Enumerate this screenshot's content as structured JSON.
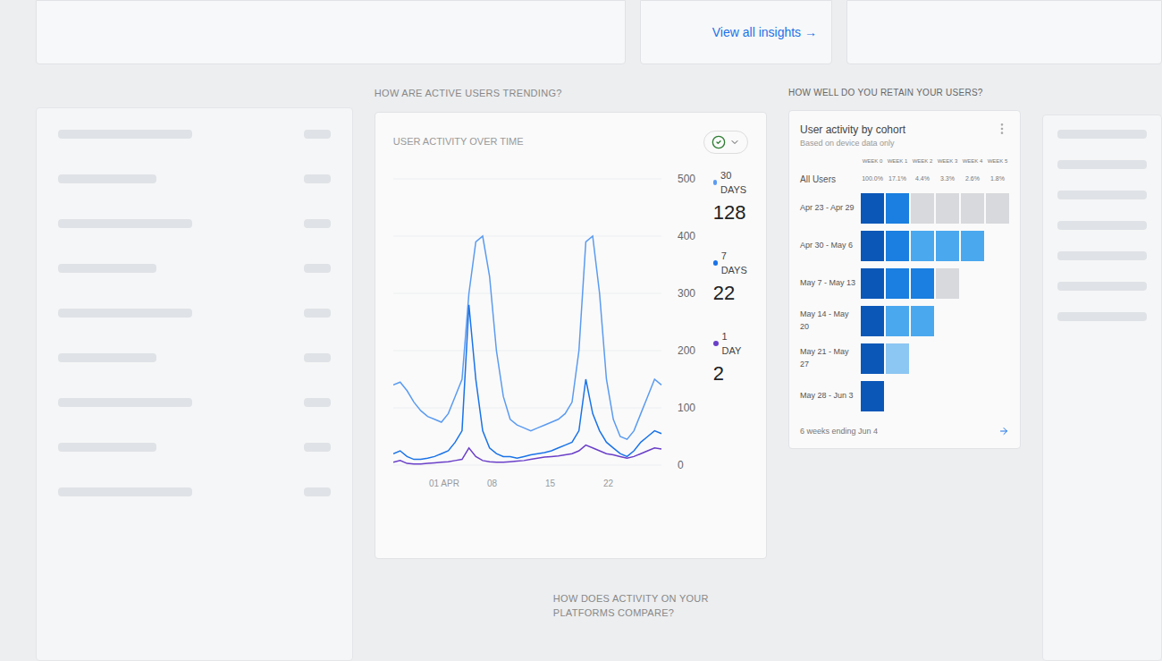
{
  "top_cards": {
    "link": "View all insights →"
  },
  "trend_section": {
    "heading": "HOW ARE ACTIVE USERS TRENDING?",
    "chart": {
      "title": "USER ACTIVITY OVER TIME",
      "y_ticks": [
        "500",
        "400",
        "300",
        "200",
        "100",
        "0"
      ],
      "x_ticks": [
        "01 APR",
        "08",
        "15",
        "22"
      ],
      "series": [
        {
          "label": "30 DAYS",
          "value": "128",
          "color": "#5b9bf0",
          "values": [
            140,
            145,
            130,
            110,
            95,
            85,
            80,
            75,
            90,
            120,
            150,
            300,
            390,
            400,
            330,
            200,
            120,
            80,
            70,
            65,
            60,
            65,
            70,
            75,
            80,
            90,
            110,
            200,
            390,
            400,
            300,
            150,
            80,
            50,
            45,
            60,
            90,
            120,
            150,
            140
          ]
        },
        {
          "label": "7 DAYS",
          "value": "22",
          "color": "#1a73e8",
          "values": [
            20,
            25,
            15,
            10,
            10,
            12,
            15,
            20,
            25,
            40,
            60,
            280,
            150,
            60,
            30,
            20,
            15,
            15,
            12,
            15,
            18,
            20,
            22,
            25,
            30,
            35,
            40,
            60,
            150,
            90,
            60,
            40,
            30,
            20,
            15,
            25,
            40,
            50,
            60,
            55
          ]
        },
        {
          "label": "1 DAY",
          "value": "2",
          "color": "#6a3fc8",
          "values": [
            5,
            8,
            3,
            2,
            2,
            3,
            4,
            5,
            6,
            8,
            10,
            30,
            15,
            8,
            6,
            5,
            5,
            6,
            7,
            8,
            10,
            12,
            14,
            15,
            16,
            18,
            20,
            25,
            35,
            30,
            25,
            20,
            18,
            15,
            12,
            15,
            20,
            25,
            30,
            28
          ]
        }
      ]
    }
  },
  "retention_section": {
    "heading": "HOW WELL DO YOU RETAIN YOUR USERS?",
    "card": {
      "title": "User activity by cohort",
      "subtitle": "Based on device data only",
      "columns": [
        "WEEK 0",
        "WEEK 1",
        "WEEK 2",
        "WEEK 3",
        "WEEK 4",
        "WEEK 5"
      ],
      "all_users": {
        "label": "All Users",
        "values": [
          "100.0%",
          "17.1%",
          "4.4%",
          "3.3%",
          "2.6%",
          "1.8%"
        ]
      },
      "rows": [
        {
          "label": "Apr 23 - Apr 29",
          "levels": [
            1,
            0.75,
            0,
            0,
            0,
            0
          ]
        },
        {
          "label": "Apr 30 - May 6",
          "levels": [
            1,
            0.75,
            0.45,
            0.45,
            0.45
          ]
        },
        {
          "label": "May 7 - May 13",
          "levels": [
            1,
            0.75,
            0.75,
            0
          ]
        },
        {
          "label": "May 14 - May 20",
          "levels": [
            1,
            0.45,
            0.45
          ]
        },
        {
          "label": "May 21 - May 27",
          "levels": [
            1,
            0.3
          ]
        },
        {
          "label": "May 28 - Jun 3",
          "levels": [
            1
          ]
        }
      ],
      "footer": "6 weeks ending Jun 4"
    }
  },
  "platform_section": {
    "heading": "HOW DOES ACTIVITY ON YOUR PLATFORMS COMPARE?"
  }
}
